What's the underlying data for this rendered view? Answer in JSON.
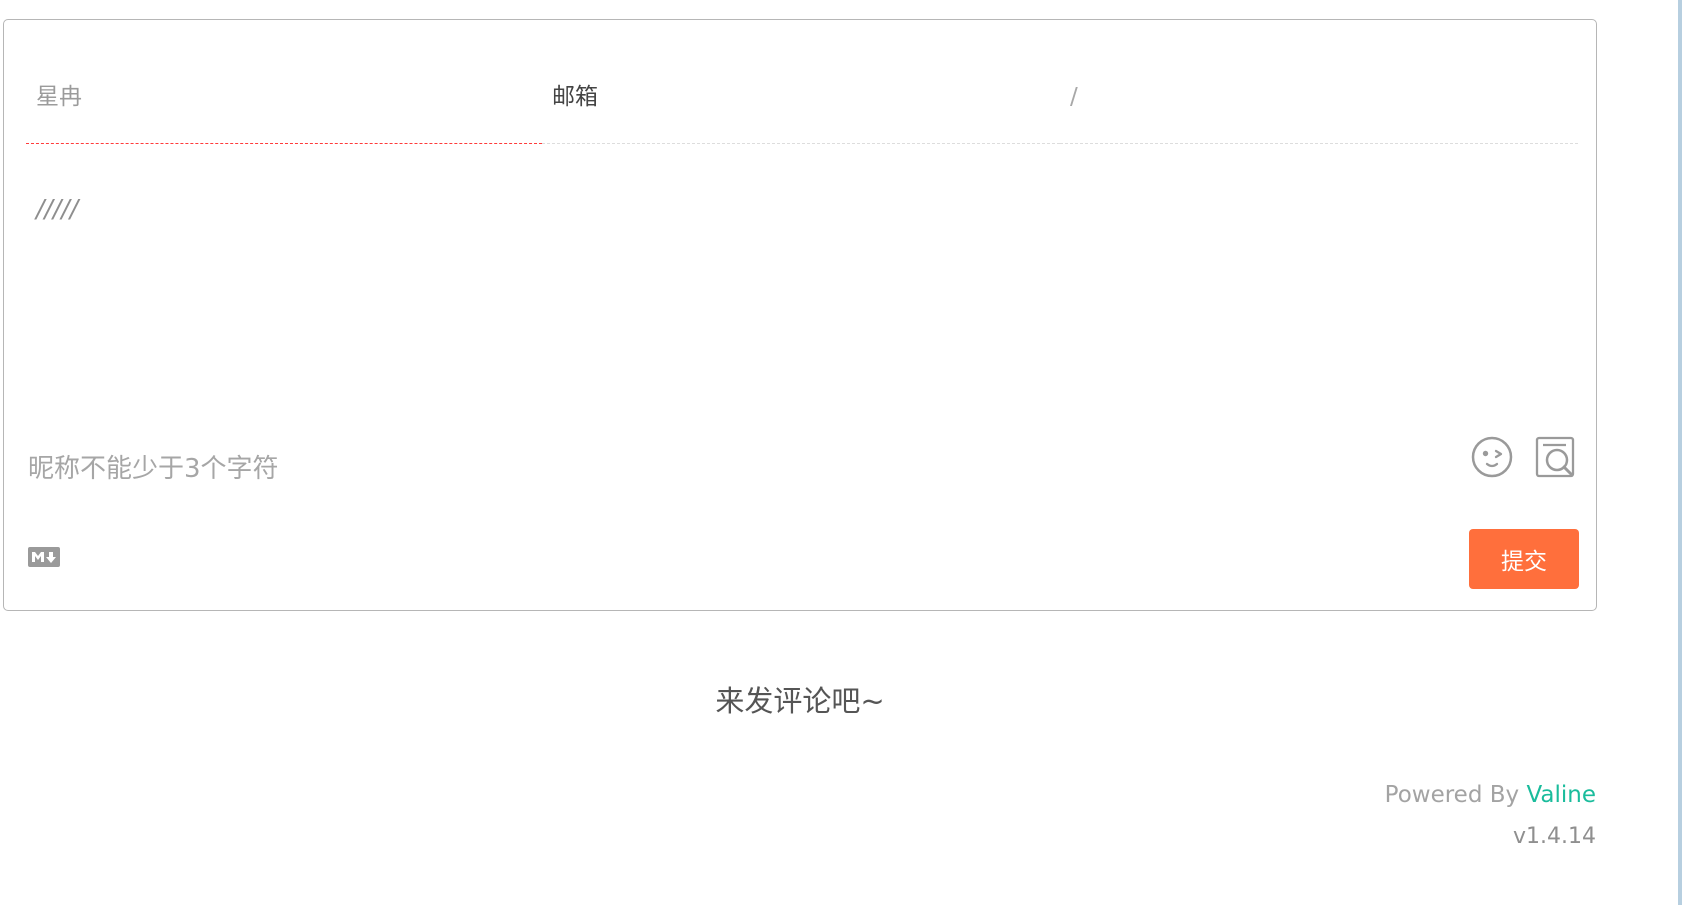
{
  "form": {
    "nick_placeholder": "星冉",
    "mail_placeholder": "邮箱",
    "link_placeholder": "/",
    "editor_placeholder": "/////",
    "warning_text": "昵称不能少于3个字符",
    "submit_label": "提交",
    "icons": {
      "emoji": "emoji-icon",
      "preview": "preview-icon",
      "markdown": "markdown-icon"
    }
  },
  "comments": {
    "empty_text": "来发评论吧~"
  },
  "footer": {
    "powered_prefix": "Powered By ",
    "powered_link": "Valine",
    "version": "v1.4.14"
  },
  "colors": {
    "accent": "#ff6f3c",
    "link": "#1abc9c",
    "error_underline": "#ff3b3b"
  }
}
